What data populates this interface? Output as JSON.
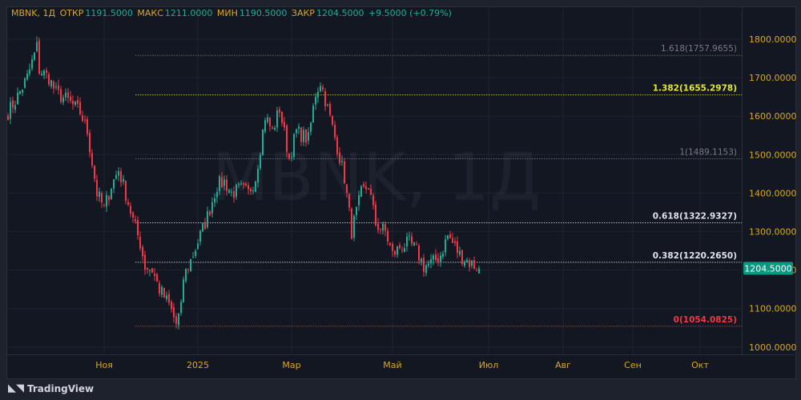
{
  "header": {
    "symbol": "MBNK, 1Д",
    "open_label": "ОТКР",
    "open": "1191.5000",
    "high_label": "МАКС",
    "high": "1211.0000",
    "low_label": "МИН",
    "low": "1190.5000",
    "close_label": "ЗАКР",
    "close": "1204.5000",
    "change": "+9.5000 (+0.79%)"
  },
  "watermark": "MBNK, 1Д",
  "brand": "TradingView",
  "colors": {
    "up": "#22ab94",
    "down": "#f23645",
    "axis_text": "#d8a72a",
    "badge": "#089981"
  },
  "chart_data": {
    "type": "candlestick",
    "title": "MBNK, 1Д",
    "ylim": [
      970,
      1840
    ],
    "y_ticks": [
      1000,
      1100,
      1200,
      1300,
      1400,
      1500,
      1600,
      1700,
      1800
    ],
    "y_tick_labels": [
      "1000.0000",
      "1100.0000",
      "1200.0000",
      "1300.0000",
      "1400.0000",
      "1500.0000",
      "1600.0000",
      "1700.0000",
      "1800.0000"
    ],
    "x_ticks": [
      {
        "label": "Ноя",
        "day": 40
      },
      {
        "label": "2025",
        "day": 79
      },
      {
        "label": "Мар",
        "day": 118
      },
      {
        "label": "Май",
        "day": 160
      },
      {
        "label": "Июл",
        "day": 200
      },
      {
        "label": "Авг",
        "day": 231
      },
      {
        "label": "Сен",
        "day": 260
      },
      {
        "label": "Окт",
        "day": 288
      }
    ],
    "days_total": 305,
    "close_path": [
      [
        0,
        1610
      ],
      [
        3,
        1640
      ],
      [
        8,
        1700
      ],
      [
        12,
        1780
      ],
      [
        13,
        1720
      ],
      [
        17,
        1700
      ],
      [
        20,
        1660
      ],
      [
        25,
        1640
      ],
      [
        30,
        1610
      ],
      [
        33,
        1560
      ],
      [
        35,
        1480
      ],
      [
        37,
        1400
      ],
      [
        40,
        1360
      ],
      [
        43,
        1420
      ],
      [
        46,
        1460
      ],
      [
        48,
        1420
      ],
      [
        52,
        1330
      ],
      [
        55,
        1270
      ],
      [
        57,
        1210
      ],
      [
        60,
        1200
      ],
      [
        63,
        1150
      ],
      [
        67,
        1110
      ],
      [
        70,
        1060
      ],
      [
        72,
        1100
      ],
      [
        73,
        1180
      ],
      [
        77,
        1240
      ],
      [
        80,
        1290
      ],
      [
        83,
        1340
      ],
      [
        87,
        1420
      ],
      [
        90,
        1430
      ],
      [
        93,
        1400
      ],
      [
        97,
        1410
      ],
      [
        100,
        1400
      ],
      [
        103,
        1440
      ],
      [
        107,
        1600
      ],
      [
        110,
        1560
      ],
      [
        113,
        1620
      ],
      [
        117,
        1490
      ],
      [
        120,
        1560
      ],
      [
        125,
        1540
      ],
      [
        128,
        1660
      ],
      [
        130,
        1690
      ],
      [
        133,
        1620
      ],
      [
        137,
        1520
      ],
      [
        140,
        1440
      ],
      [
        143,
        1300
      ],
      [
        147,
        1400
      ],
      [
        150,
        1420
      ],
      [
        153,
        1320
      ],
      [
        157,
        1300
      ],
      [
        160,
        1240
      ],
      [
        163,
        1260
      ],
      [
        167,
        1270
      ],
      [
        170,
        1250
      ],
      [
        173,
        1210
      ],
      [
        177,
        1220
      ],
      [
        180,
        1240
      ],
      [
        183,
        1290
      ],
      [
        185,
        1270
      ],
      [
        188,
        1240
      ],
      [
        192,
        1220
      ],
      [
        196,
        1204.5
      ]
    ],
    "last_price": "1204.5000",
    "fib_levels": [
      {
        "label": "1.618(1757.9655)",
        "value": 1757.9655,
        "color": "#787b86"
      },
      {
        "label": "1.382(1655.2978)",
        "value": 1655.2978,
        "color": "#e6e63c"
      },
      {
        "label": "1(1489.1153)",
        "value": 1489.1153,
        "color": "#787b86"
      },
      {
        "label": "0.618(1322.9327)",
        "value": 1322.9327,
        "color": "#e0e3eb"
      },
      {
        "label": "0.382(1220.2650)",
        "value": 1220.265,
        "color": "#e0e3eb"
      },
      {
        "label": "0(1054.0825)",
        "value": 1054.0825,
        "color": "#f23645"
      }
    ],
    "fib_start_day": 53
  }
}
